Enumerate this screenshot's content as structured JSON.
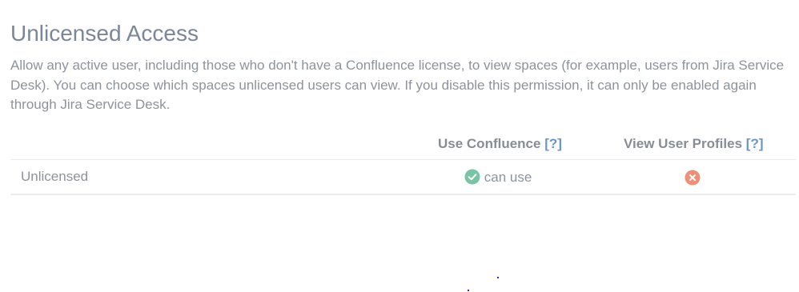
{
  "page": {
    "title": "Unlicensed Access",
    "description": "Allow any active user, including those who don't have a Confluence license, to view spaces (for example, users from Jira Service Desk). You can choose which spaces unlicensed users can view. If you disable this permission, it can only be enabled again through Jira Service Desk."
  },
  "table": {
    "columns": [
      {
        "label": "Use Confluence",
        "help": "[?]"
      },
      {
        "label": "View User Profiles",
        "help": "[?]"
      }
    ],
    "rows": [
      {
        "label": "Unlicensed",
        "use_confluence": {
          "icon": "check-circle-icon",
          "text": "can use"
        },
        "view_user_profiles": {
          "icon": "error-x-circle-icon"
        }
      }
    ]
  },
  "colors": {
    "title": "#7a8699",
    "text": "#8d939b",
    "link": "#6b95c9",
    "success": "#79c3a6",
    "error": "#ee8f79"
  }
}
